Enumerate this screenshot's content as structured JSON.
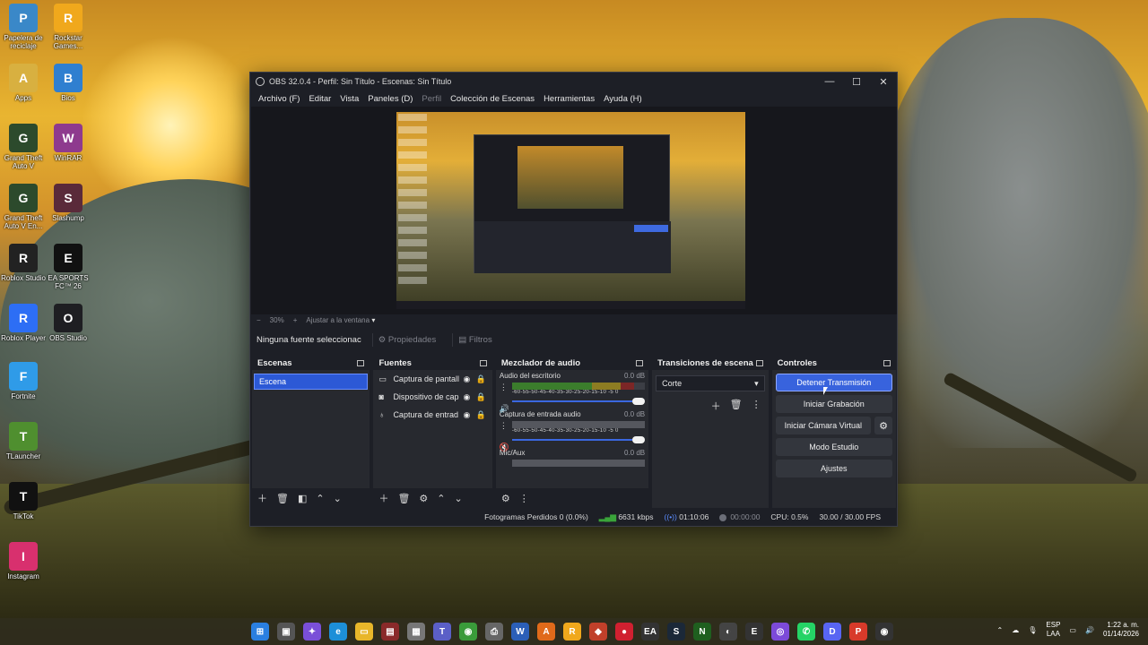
{
  "desktop": {
    "icons": [
      {
        "label": "Papelera de reciclaje",
        "icon": "recycle-bin-icon",
        "color": "#3a88c8"
      },
      {
        "label": "Rockstar Games...",
        "icon": "rockstar-icon",
        "color": "#f0a81c"
      },
      {
        "label": "Apps",
        "icon": "apps-folder-icon",
        "color": "#d8b040"
      },
      {
        "label": "Bios",
        "icon": "bios-icon",
        "color": "#2f7fd0"
      },
      {
        "label": "Grand Theft Auto V",
        "icon": "gta5-icon",
        "color": "#2c4a2c"
      },
      {
        "label": "WinRAR",
        "icon": "winrar-icon",
        "color": "#8e3a8e"
      },
      {
        "label": "Grand Theft Auto V En...",
        "icon": "gta5-enhanced-icon",
        "color": "#2c4a2c"
      },
      {
        "label": "Slashump",
        "icon": "slashump-icon",
        "color": "#5a2a3a"
      },
      {
        "label": "Roblox Studio",
        "icon": "roblox-studio-icon",
        "color": "#222222"
      },
      {
        "label": "EA SPORTS FC™ 26",
        "icon": "ea-fc-icon",
        "color": "#111111"
      },
      {
        "label": "Roblox Player",
        "icon": "roblox-player-icon",
        "color": "#2d6ef5"
      },
      {
        "label": "OBS Studio",
        "icon": "obs-icon",
        "color": "#1e1e22"
      },
      {
        "label": "Fortnite",
        "icon": "fortnite-icon",
        "color": "#2f9be8"
      },
      {
        "label": "TLauncher",
        "icon": "tlauncher-icon",
        "color": "#4f8f2f"
      },
      {
        "label": "TikTok",
        "icon": "tiktok-icon",
        "color": "#111111"
      },
      {
        "label": "Instagram",
        "icon": "instagram-icon",
        "color": "#d8306e"
      }
    ]
  },
  "obs": {
    "title": "OBS 32.0.4 - Perfil: Sin Título - Escenas: Sin Título",
    "menu": [
      "Archivo (F)",
      "Editar",
      "Vista",
      "Paneles (D)",
      "Perfil",
      "Colección de Escenas",
      "Herramientas",
      "Ayuda (H)"
    ],
    "zoom": {
      "minus": "−",
      "value": "30%",
      "plus": "+",
      "fit": "Ajustar a la ventana"
    },
    "source_toolbar": {
      "none_selected": "Ninguna fuente seleccionac",
      "properties": "Propiedades",
      "filters": "Filtros"
    },
    "docks": {
      "scenes": {
        "title": "Escenas",
        "items": [
          "Escena"
        ]
      },
      "sources": {
        "title": "Fuentes",
        "items": [
          {
            "name": "Captura de pantall",
            "icon": "monitor-icon"
          },
          {
            "name": "Dispositivo de cap",
            "icon": "camera-icon"
          },
          {
            "name": "Captura de entrad",
            "icon": "microphone-icon"
          }
        ]
      },
      "mixer": {
        "title": "Mezclador de audio",
        "channels": [
          {
            "name": "Audio del escritorio",
            "db": "0.0 dB",
            "level": 0.92
          },
          {
            "name": "Captura de entrada audio",
            "db": "0.0 dB",
            "level": 0.0
          },
          {
            "name": "Mic/Aux",
            "db": "0.0 dB",
            "level": 0.0
          }
        ],
        "ticks": "-60-55-50-45-40-35-30-25-20-15-10 -5  0"
      },
      "transitions": {
        "title": "Transiciones de escena",
        "selected": "Corte"
      },
      "controls": {
        "title": "Controles",
        "buttons": {
          "stream": "Detener Transmisión",
          "record": "Iniciar Grabación",
          "virtual_cam": "Iniciar Cámara Virtual",
          "studio": "Modo Estudio",
          "settings": "Ajustes"
        }
      }
    },
    "status": {
      "dropped": "Fotogramas Perdidos 0 (0.0%)",
      "bitrate": "6631 kbps",
      "stream_time": "01:10:06",
      "rec_time": "00:00:00",
      "cpu": "CPU: 0.5%",
      "fps": "30.00 / 30.00 FPS"
    }
  },
  "taskbar": {
    "lang": "ESP",
    "region": "LAA",
    "time": "1:22 a. m.",
    "date": "01/14/2026"
  },
  "colors": {
    "accent": "#3863dd",
    "meter_green": "#3b7d2c",
    "meter_yellow": "#8d7c22",
    "meter_red": "#7c2626"
  }
}
